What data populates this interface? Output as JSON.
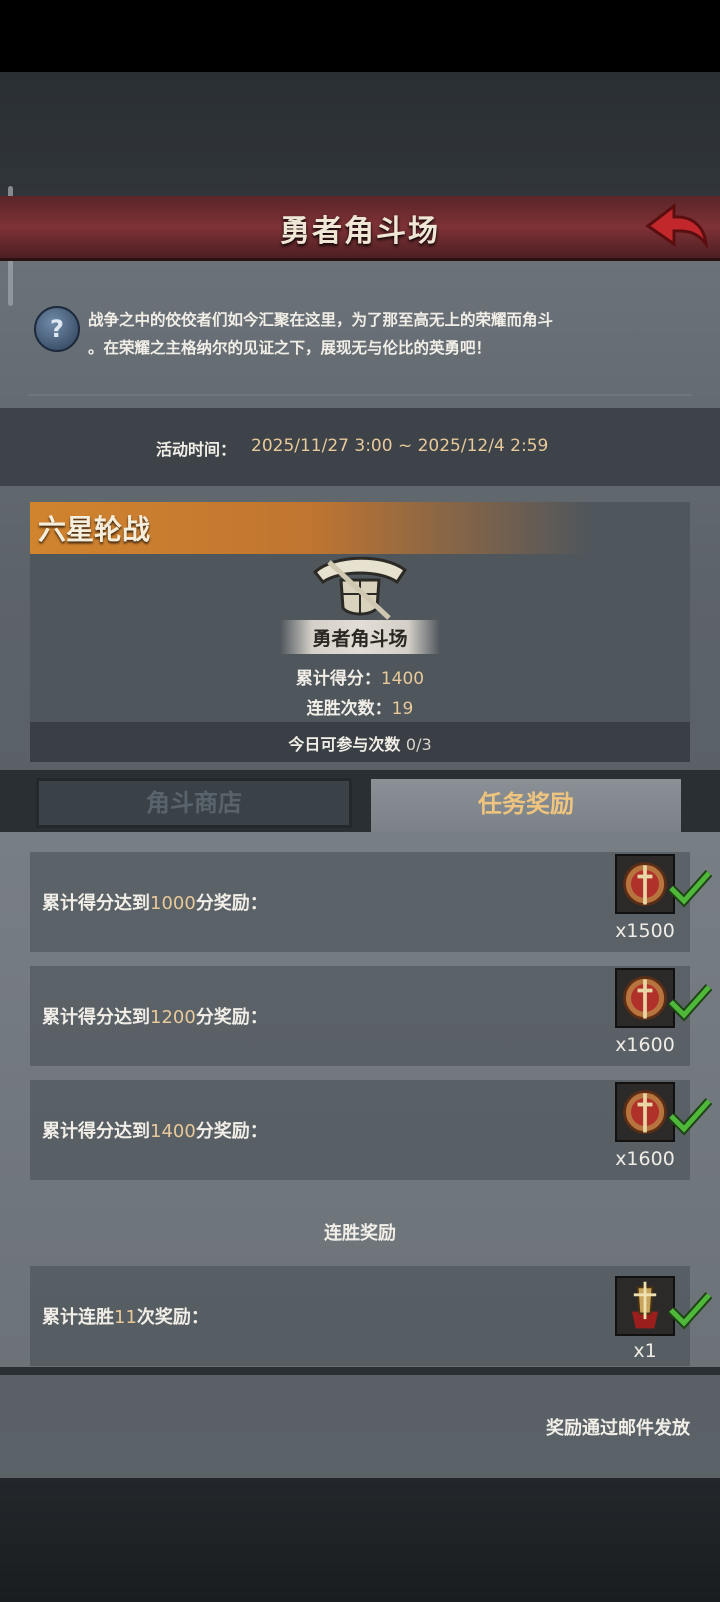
{
  "header": {
    "title": "勇者角斗场"
  },
  "description": {
    "line1": "战争之中的佼佼者们如今汇聚在这里，为了那至高无上的荣耀而角斗",
    "line2": "。在荣耀之主格纳尔的见证之下，展现无与伦比的英勇吧！"
  },
  "event_time": {
    "label": "活动时间：",
    "value": "2025/11/27 3:00 ~ 2025/12/4 2:59"
  },
  "event": {
    "title": "六星轮战",
    "plaque": "勇者角斗场",
    "score_label": "累计得分：",
    "score_value": "1400",
    "streak_label": "连胜次数：",
    "streak_value": "19",
    "attempts_label": "今日可参与次数",
    "attempts_value": "0/3"
  },
  "tabs": [
    {
      "label": "角斗商店",
      "active": false
    },
    {
      "label": "任务奖励",
      "active": true
    }
  ],
  "rewards": [
    {
      "label_pre": "累计得分达到",
      "num": "1000",
      "label_post": "分奖励：",
      "qty": "x1500",
      "claimed": true,
      "icon": "medal-icon"
    },
    {
      "label_pre": "累计得分达到",
      "num": "1200",
      "label_post": "分奖励：",
      "qty": "x1600",
      "claimed": true,
      "icon": "medal-icon"
    },
    {
      "label_pre": "累计得分达到",
      "num": "1400",
      "label_post": "分奖励：",
      "qty": "x1600",
      "claimed": true,
      "icon": "medal-icon"
    }
  ],
  "streak_section": {
    "title": "连胜奖励",
    "items": [
      {
        "label_pre": "累计连胜",
        "num": "11",
        "label_post": "次奖励：",
        "qty": "x1",
        "claimed": true,
        "icon": "sword-shield-icon"
      }
    ]
  },
  "footer": {
    "note": "奖励通过邮件发放"
  },
  "colors": {
    "header_red": "#7e3236",
    "gold_text": "#e8c99a",
    "tab_active_text": "#efc47e",
    "check_green": "#4fb83a"
  }
}
